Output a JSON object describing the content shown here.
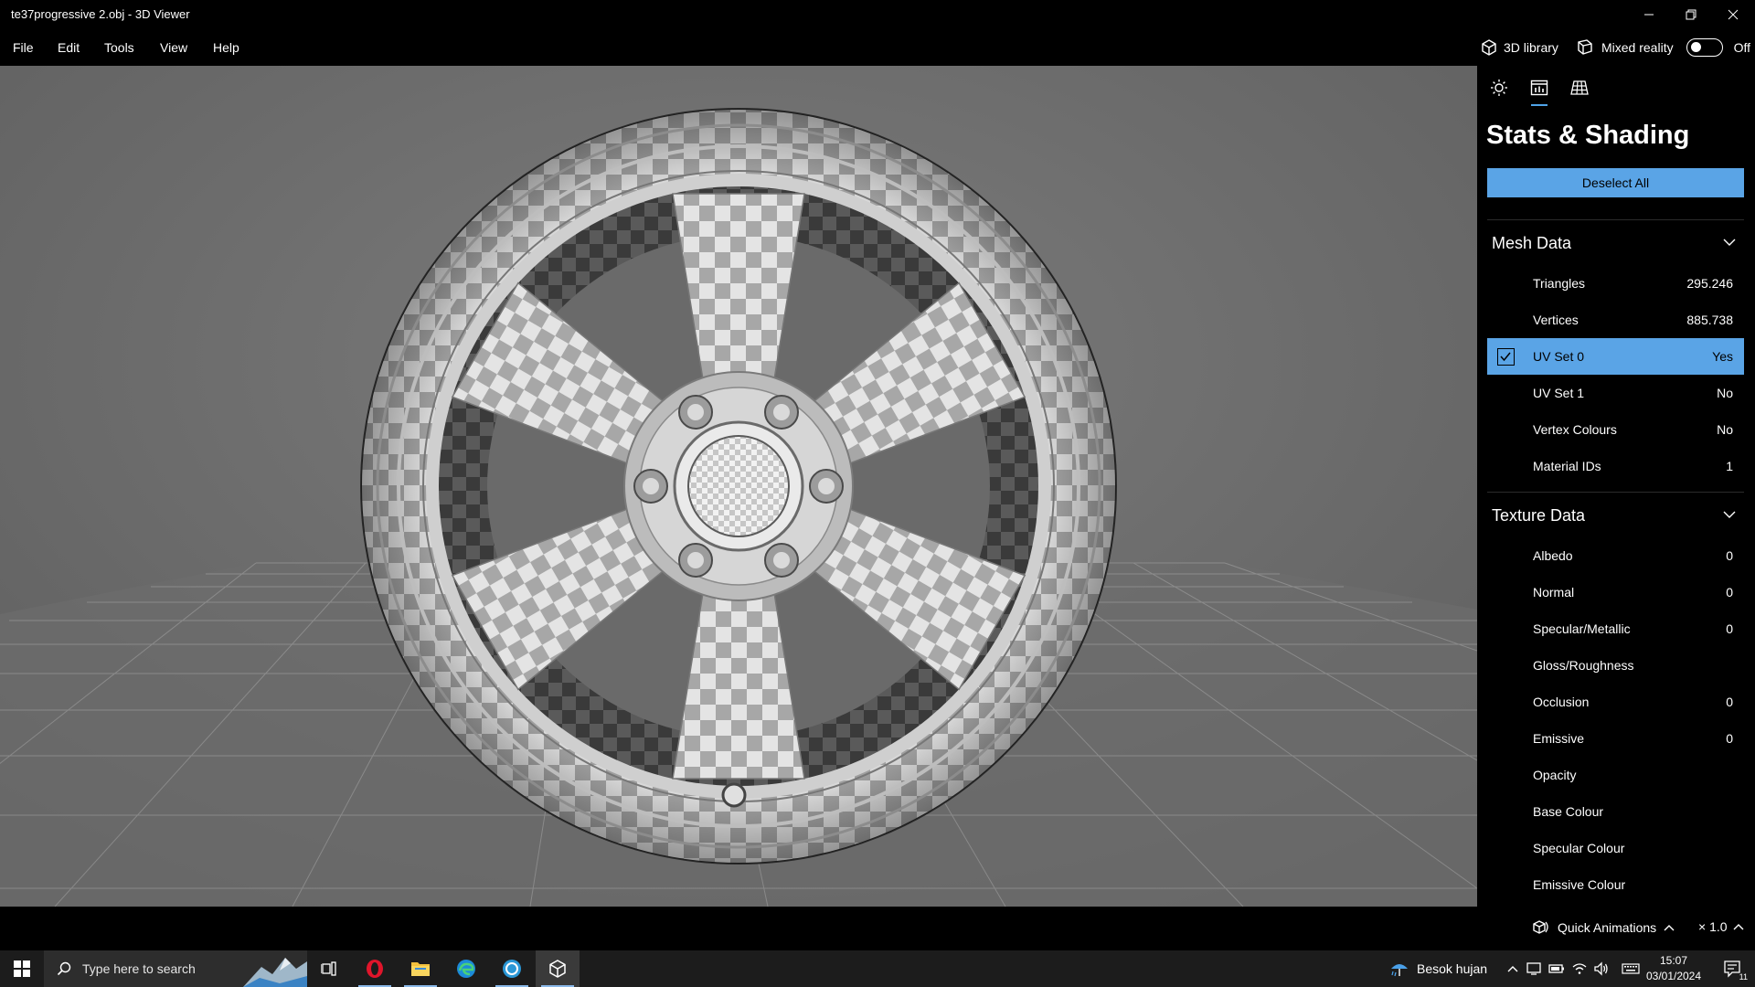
{
  "window": {
    "title": "te37progressive 2.obj - 3D Viewer"
  },
  "menubar": {
    "items": [
      "File",
      "Edit",
      "Tools",
      "View",
      "Help"
    ],
    "library_label": "3D library",
    "mixed_reality_label": "Mixed reality",
    "mixed_reality_state": "Off"
  },
  "panel": {
    "title": "Stats & Shading",
    "deselect_label": "Deselect All",
    "mesh_section": "Mesh Data",
    "mesh_rows": [
      {
        "label": "Triangles",
        "value": "295.246"
      },
      {
        "label": "Vertices",
        "value": "885.738"
      },
      {
        "label": "UV Set 0",
        "value": "Yes"
      },
      {
        "label": "UV Set 1",
        "value": "No"
      },
      {
        "label": "Vertex Colours",
        "value": "No"
      },
      {
        "label": "Material IDs",
        "value": "1"
      }
    ],
    "texture_section": "Texture Data",
    "texture_rows": [
      {
        "label": "Albedo",
        "value": "0"
      },
      {
        "label": "Normal",
        "value": "0"
      },
      {
        "label": "Specular/Metallic",
        "value": "0"
      },
      {
        "label": "Gloss/Roughness",
        "value": ""
      },
      {
        "label": "Occlusion",
        "value": "0"
      },
      {
        "label": "Emissive",
        "value": "0"
      },
      {
        "label": "Opacity",
        "value": ""
      },
      {
        "label": "Base Colour",
        "value": ""
      },
      {
        "label": "Specular Colour",
        "value": ""
      },
      {
        "label": "Emissive Colour",
        "value": ""
      }
    ]
  },
  "bottombar": {
    "quick_animations": "Quick Animations",
    "speed": "× 1.0"
  },
  "taskbar": {
    "search_placeholder": "Type here to search",
    "weather": "Besok hujan",
    "time": "15:07",
    "date": "03/01/2024",
    "notification_count": "11"
  },
  "colors": {
    "accent": "#5aa4e6",
    "viewport": "#727272",
    "panel": "#000000"
  }
}
